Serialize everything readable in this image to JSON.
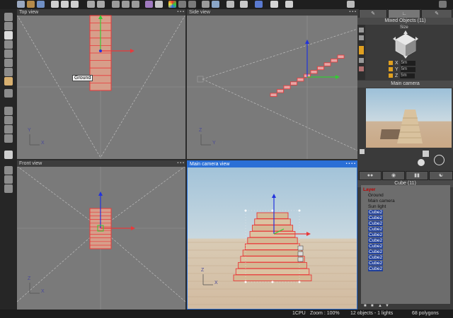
{
  "viewports": {
    "top": {
      "title": "Top view",
      "ground_label": "Ground",
      "axis_y": "Y",
      "axis_x": "X"
    },
    "side": {
      "title": "Side view",
      "axis_y": "Z",
      "axis_x": "Y"
    },
    "front": {
      "title": "Front view",
      "axis_y": "Z",
      "axis_x": "X"
    },
    "camera": {
      "title": "Main camera view",
      "axis_y": "Z",
      "axis_x": "X"
    }
  },
  "right_panel": {
    "mixed_title": "Mixed Objects (11)",
    "size_label": "Size",
    "coords": [
      {
        "axis": "X",
        "value": "5m"
      },
      {
        "axis": "Y",
        "value": "5m"
      },
      {
        "axis": "Z",
        "value": "5m"
      }
    ],
    "camera_title": "Main camera",
    "tree_title": "Cube (11)",
    "tree": [
      {
        "label": "Layer",
        "kind": "layer"
      },
      {
        "label": "Ground",
        "kind": "plain"
      },
      {
        "label": "Main camera",
        "kind": "plain"
      },
      {
        "label": "Sun light",
        "kind": "plain"
      },
      {
        "label": "Cube2",
        "kind": "sel"
      },
      {
        "label": "Cube2",
        "kind": "sel"
      },
      {
        "label": "Cube2",
        "kind": "sel"
      },
      {
        "label": "Cube2",
        "kind": "sel"
      },
      {
        "label": "Cube2",
        "kind": "sel"
      },
      {
        "label": "Cube2",
        "kind": "sel"
      },
      {
        "label": "Cube2",
        "kind": "sel"
      },
      {
        "label": "Cube2",
        "kind": "sel"
      },
      {
        "label": "Cube2",
        "kind": "sel"
      },
      {
        "label": "Cube2",
        "kind": "sel"
      },
      {
        "label": "Cube2",
        "kind": "sel"
      }
    ]
  },
  "status": {
    "cpu": "1CPU",
    "zoom": "Zoom : 100%",
    "objects": "12 objects - 1 lights",
    "polygons": "68 polygons"
  },
  "colors": {
    "viewport_bg": "#7a7a7a",
    "selection_red": "#e8393a",
    "gizmo_green": "#33cc33",
    "gizmo_blue": "#2233dd",
    "selected_border": "#2a6fd6",
    "tree_selected": "#1f3f9a"
  }
}
